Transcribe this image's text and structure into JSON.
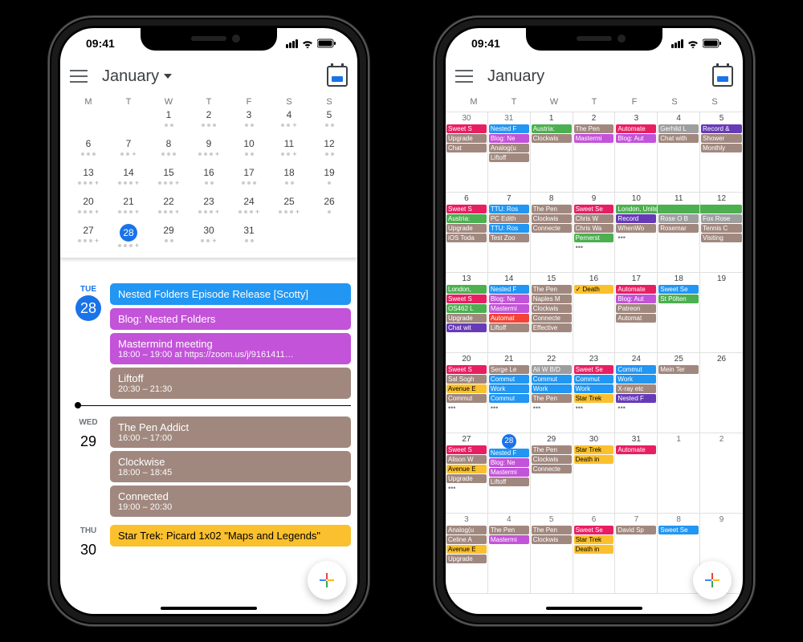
{
  "status": {
    "time": "09:41"
  },
  "header": {
    "month": "January"
  },
  "dow": [
    "M",
    "T",
    "W",
    "T",
    "F",
    "S",
    "S"
  ],
  "mini_weeks": [
    [
      {
        "n": "",
        "dim": true
      },
      {
        "n": "",
        "dim": true
      },
      {
        "n": "1",
        "dots": [
          "d-br",
          "d-pur"
        ]
      },
      {
        "n": "2",
        "dots": [
          "d-br",
          "d-mag",
          "d-gn"
        ]
      },
      {
        "n": "3",
        "dots": [
          "d-pink",
          "d-mag"
        ]
      },
      {
        "n": "4",
        "dots": [
          "d-br",
          "d-pur"
        ],
        "plus": true
      },
      {
        "n": "5",
        "dots": [
          "d-br",
          "d-pur"
        ]
      }
    ],
    [
      {
        "n": "6",
        "dots": [
          "d-pink",
          "d-br",
          "d-blue"
        ]
      },
      {
        "n": "7",
        "dots": [
          "d-blue",
          "d-br"
        ],
        "plus": true
      },
      {
        "n": "8",
        "dots": [
          "d-br",
          "d-mag",
          "d-gn"
        ]
      },
      {
        "n": "9",
        "dots": [
          "d-pink",
          "d-br",
          "d-yel"
        ],
        "plus": true
      },
      {
        "n": "10",
        "dots": [
          "d-blue",
          "d-pur"
        ]
      },
      {
        "n": "11",
        "dots": [
          "d-br",
          "d-gn"
        ],
        "plus": true
      },
      {
        "n": "12",
        "dots": [
          "d-pur",
          "d-br"
        ]
      }
    ],
    [
      {
        "n": "13",
        "dots": [
          "d-gn",
          "d-pink",
          "d-br"
        ],
        "plus": true
      },
      {
        "n": "14",
        "dots": [
          "d-blue",
          "d-mag",
          "d-br"
        ],
        "plus": true
      },
      {
        "n": "15",
        "dots": [
          "d-br",
          "d-gn",
          "d-mag"
        ],
        "plus": true
      },
      {
        "n": "16",
        "dots": [
          "d-yel",
          "d-br"
        ]
      },
      {
        "n": "17",
        "dots": [
          "d-pink",
          "d-mag",
          "d-blue"
        ]
      },
      {
        "n": "18",
        "dots": [
          "d-blue",
          "d-br"
        ]
      },
      {
        "n": "19",
        "dots": [
          "d-br"
        ]
      }
    ],
    [
      {
        "n": "20",
        "dots": [
          "d-pink",
          "d-br",
          "d-blue"
        ],
        "plus": true
      },
      {
        "n": "21",
        "dots": [
          "d-blue",
          "d-br",
          "d-mag"
        ],
        "plus": true
      },
      {
        "n": "22",
        "dots": [
          "d-br",
          "d-gn",
          "d-yel"
        ],
        "plus": true
      },
      {
        "n": "23",
        "dots": [
          "d-br",
          "d-blue",
          "d-yel"
        ],
        "plus": true
      },
      {
        "n": "24",
        "dots": [
          "d-blue",
          "d-br",
          "d-mag"
        ],
        "plus": true
      },
      {
        "n": "25",
        "dots": [
          "d-pur",
          "d-br",
          "d-yel"
        ],
        "plus": true
      },
      {
        "n": "26",
        "dots": [
          "d-br"
        ]
      }
    ],
    [
      {
        "n": "27",
        "dots": [
          "d-pink",
          "d-br",
          "d-blue"
        ],
        "plus": true
      },
      {
        "n": "28",
        "sel": true,
        "dots": [
          "d-blue",
          "d-mag",
          "d-br"
        ],
        "plus": true
      },
      {
        "n": "29",
        "dots": [
          "d-br",
          "d-gn"
        ]
      },
      {
        "n": "30",
        "dots": [
          "d-yel",
          "d-br"
        ],
        "plus": true
      },
      {
        "n": "31",
        "dots": [
          "d-pink",
          "d-blue"
        ]
      },
      {
        "n": "",
        "dim": true
      },
      {
        "n": "",
        "dim": true
      }
    ]
  ],
  "agenda": [
    {
      "label": "TUE",
      "num": "28",
      "sel": true,
      "events": [
        {
          "t": "Nested Folders Episode Release [Scotty]",
          "c": "c-blue"
        },
        {
          "t": "Blog: Nested Folders",
          "c": "c-mag"
        },
        {
          "t": "Mastermind meeting",
          "s": "18:00 – 19:00 at https://zoom.us/j/9161411…",
          "c": "c-mag"
        },
        {
          "t": "Liftoff",
          "s": "20:30 – 21:30",
          "c": "c-br",
          "now": true
        }
      ]
    },
    {
      "label": "WED",
      "num": "29",
      "events": [
        {
          "t": "The Pen Addict",
          "s": "16:00 – 17:00",
          "c": "c-br"
        },
        {
          "t": "Clockwise",
          "s": "18:00 – 18:45",
          "c": "c-br"
        },
        {
          "t": "Connected",
          "s": "19:00 – 20:30",
          "c": "c-br"
        }
      ]
    },
    {
      "label": "THU",
      "num": "30",
      "events": [
        {
          "t": "Star Trek: Picard 1x02 \"Maps and Legends\"",
          "c": "c-yel"
        }
      ]
    }
  ],
  "month_cells": [
    {
      "n": "30",
      "cur": false,
      "ev": [
        [
          "Sweet S",
          "c-pink"
        ],
        [
          "Upgrade",
          "c-br"
        ],
        [
          "Chat",
          "c-br"
        ]
      ]
    },
    {
      "n": "31",
      "cur": false,
      "ev": [
        [
          "Nested F",
          "c-blue"
        ],
        [
          "Blog: Ne",
          "c-mag"
        ],
        [
          "Analog(u",
          "c-br"
        ],
        [
          "Liftoff",
          "c-br"
        ]
      ]
    },
    {
      "n": "1",
      "ev": [
        [
          "Austria: ",
          "c-gn"
        ],
        [
          "Clockwis",
          "c-br"
        ]
      ]
    },
    {
      "n": "2",
      "ev": [
        [
          "The Pen ",
          "c-br"
        ],
        [
          "Mastermi",
          "c-mag"
        ]
      ]
    },
    {
      "n": "3",
      "ev": [
        [
          "Automate",
          "c-pink"
        ],
        [
          "Blog: Aut",
          "c-mag"
        ]
      ]
    },
    {
      "n": "4",
      "ev": [
        [
          "Gerhild L",
          "c-gr"
        ],
        [
          "Chat with",
          "c-br"
        ]
      ]
    },
    {
      "n": "5",
      "ev": [
        [
          "Record &",
          "c-pur"
        ],
        [
          "Shower",
          "c-br"
        ],
        [
          "Monthly ",
          "c-br"
        ]
      ]
    },
    {
      "n": "6",
      "ev": [
        [
          "Sweet S",
          "c-pink"
        ],
        [
          "Austria: ",
          "c-gn"
        ],
        [
          "Upgrade",
          "c-br"
        ],
        [
          "iOS Toda",
          "c-br"
        ]
      ]
    },
    {
      "n": "7",
      "ev": [
        [
          "TTU: Ros",
          "c-blue"
        ],
        [
          "PC Edith",
          "c-br"
        ],
        [
          "TTU: Ros",
          "c-blue"
        ],
        [
          "Test Zoo",
          "c-br"
        ]
      ]
    },
    {
      "n": "8",
      "ev": [
        [
          "The Pen ",
          "c-br"
        ],
        [
          "Clockwis",
          "c-br"
        ],
        [
          "Connecte",
          "c-br"
        ]
      ]
    },
    {
      "n": "9",
      "ev": [
        [
          "Sweet Se",
          "c-pink"
        ],
        [
          "Chris W ",
          "c-br"
        ],
        [
          "Chris Wa",
          "c-br"
        ],
        [
          "Pernerst",
          "c-gn"
        ]
      ],
      "more": true
    },
    {
      "n": "10",
      "ev": [
        [
          "London, United Kingdom, Janu",
          "c-gn",
          "rt"
        ],
        [
          "Record",
          "c-pur"
        ],
        [
          "WhenWo",
          "c-br"
        ]
      ],
      "more": true
    },
    {
      "n": "11",
      "ev": [
        [
          "",
          "c-gn",
          "mid"
        ],
        [
          "Rose O B",
          "c-gr"
        ],
        [
          "Rosemar",
          "c-br"
        ]
      ]
    },
    {
      "n": "12",
      "ev": [
        [
          "",
          "c-gn",
          "lf"
        ],
        [
          "Fox Rose",
          "c-gr"
        ],
        [
          "Tennis C",
          "c-br"
        ],
        [
          "Visiting",
          "c-br"
        ]
      ]
    },
    {
      "n": "13",
      "ev": [
        [
          "London, ",
          "c-gn"
        ],
        [
          "Sweet S",
          "c-pink"
        ],
        [
          "OS462 L",
          "c-gn"
        ],
        [
          "Upgrade",
          "c-br"
        ],
        [
          "Chat wit",
          "c-pur"
        ]
      ]
    },
    {
      "n": "14",
      "ev": [
        [
          "Nested F",
          "c-blue"
        ],
        [
          "Blog: Ne",
          "c-mag"
        ],
        [
          "Mastermi",
          "c-mag"
        ],
        [
          "Automat",
          "c-rd"
        ],
        [
          "Liftoff",
          "c-br"
        ]
      ]
    },
    {
      "n": "15",
      "ev": [
        [
          "The Pen ",
          "c-br"
        ],
        [
          "Naples M",
          "c-br"
        ],
        [
          "Clockwis",
          "c-br"
        ],
        [
          "Connecte",
          "c-br"
        ],
        [
          "Effective",
          "c-br"
        ]
      ]
    },
    {
      "n": "16",
      "ev": [
        [
          "✓ Death",
          "c-yel"
        ]
      ]
    },
    {
      "n": "17",
      "ev": [
        [
          "Automate",
          "c-pink"
        ],
        [
          "Blog: Aut",
          "c-mag"
        ],
        [
          "Patreon ",
          "c-br"
        ],
        [
          "Automat",
          "c-br"
        ]
      ]
    },
    {
      "n": "18",
      "ev": [
        [
          "Sweet Se",
          "c-blue"
        ],
        [
          "St Pölten",
          "c-gn"
        ]
      ]
    },
    {
      "n": "19",
      "ev": []
    },
    {
      "n": "20",
      "ev": [
        [
          "Sweet S",
          "c-pink"
        ],
        [
          "Sal Sogh",
          "c-br"
        ],
        [
          "Avenue E",
          "c-yel"
        ],
        [
          "Commut",
          "c-br"
        ]
      ],
      "more": true
    },
    {
      "n": "21",
      "ev": [
        [
          "Serge Le",
          "c-br"
        ],
        [
          "Commut",
          "c-blue"
        ],
        [
          "Work",
          "c-blue"
        ],
        [
          "Commut",
          "c-blue"
        ]
      ],
      "more": true
    },
    {
      "n": "22",
      "ev": [
        [
          "Ali W B/D",
          "c-gr"
        ],
        [
          "Commut",
          "c-blue"
        ],
        [
          "Work",
          "c-blue"
        ],
        [
          "The Pen ",
          "c-br"
        ]
      ],
      "more": true
    },
    {
      "n": "23",
      "ev": [
        [
          "Sweet Se",
          "c-pink"
        ],
        [
          "Commut",
          "c-blue"
        ],
        [
          "Work",
          "c-blue"
        ],
        [
          "Star Trek",
          "c-yel"
        ]
      ],
      "more": true
    },
    {
      "n": "24",
      "ev": [
        [
          "Commut",
          "c-blue"
        ],
        [
          "Work",
          "c-blue"
        ],
        [
          "X-ray etc",
          "c-br"
        ],
        [
          "Nested F",
          "c-pur"
        ]
      ],
      "more": true
    },
    {
      "n": "25",
      "ev": [
        [
          "Mein Ter",
          "c-br"
        ]
      ]
    },
    {
      "n": "26",
      "ev": []
    },
    {
      "n": "27",
      "ev": [
        [
          "Sweet S",
          "c-pink"
        ],
        [
          "Alison W",
          "c-br"
        ],
        [
          "Avenue E",
          "c-yel"
        ],
        [
          "Upgrade",
          "c-br"
        ]
      ],
      "more": true
    },
    {
      "n": "28",
      "sel": true,
      "ev": [
        [
          "Nested F",
          "c-blue"
        ],
        [
          "Blog: Ne",
          "c-mag"
        ],
        [
          "Mastermi",
          "c-mag"
        ],
        [
          "Liftoff",
          "c-br"
        ]
      ]
    },
    {
      "n": "29",
      "ev": [
        [
          "The Pen ",
          "c-br"
        ],
        [
          "Clockwis",
          "c-br"
        ],
        [
          "Connecte",
          "c-br"
        ]
      ]
    },
    {
      "n": "30",
      "ev": [
        [
          "Star Trek",
          "c-yel"
        ],
        [
          "Death in",
          "c-yel"
        ]
      ]
    },
    {
      "n": "31",
      "ev": [
        [
          "Automate",
          "c-pink"
        ]
      ]
    },
    {
      "n": "1",
      "cur": false,
      "ev": []
    },
    {
      "n": "2",
      "cur": false,
      "ev": []
    },
    {
      "n": "3",
      "cur": false,
      "ev": [
        [
          "Analog(u",
          "c-br"
        ],
        [
          "Celine A",
          "c-br"
        ],
        [
          "Avenue E",
          "c-yel"
        ],
        [
          "Upgrade",
          "c-br"
        ]
      ]
    },
    {
      "n": "4",
      "cur": false,
      "ev": [
        [
          "The Pen ",
          "c-br"
        ],
        [
          "Mastermi",
          "c-mag"
        ]
      ]
    },
    {
      "n": "5",
      "cur": false,
      "ev": [
        [
          "The Pen ",
          "c-br"
        ],
        [
          "Clockwis",
          "c-br"
        ]
      ]
    },
    {
      "n": "6",
      "cur": false,
      "ev": [
        [
          "Sweet Se",
          "c-pink"
        ],
        [
          "Star Trek",
          "c-yel"
        ],
        [
          "Death in",
          "c-yel"
        ]
      ]
    },
    {
      "n": "7",
      "cur": false,
      "ev": [
        [
          "David Sp",
          "c-br"
        ]
      ]
    },
    {
      "n": "8",
      "cur": false,
      "ev": [
        [
          "Sweet Se",
          "c-blue"
        ]
      ]
    },
    {
      "n": "9",
      "cur": false,
      "ev": []
    }
  ]
}
